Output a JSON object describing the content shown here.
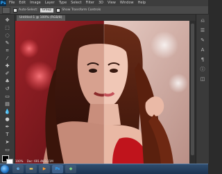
{
  "app": {
    "logo_text": "Ps"
  },
  "menu": {
    "items": [
      "File",
      "Edit",
      "Image",
      "Layer",
      "Type",
      "Select",
      "Filter",
      "3D",
      "View",
      "Window",
      "Help"
    ]
  },
  "options_bar": {
    "auto_select_label": "Auto-Select:",
    "auto_select_value": "Group",
    "show_transform_label": "Show Transform Controls"
  },
  "document": {
    "tab_label": "Untitled-1 @ 100% (RGB/8)"
  },
  "status_bar": {
    "zoom": "100%",
    "doc_info": "Doc: 691.4K/3.21M"
  },
  "taskbar": {
    "items": [
      "ie",
      "folder",
      "media",
      "ps",
      "app"
    ]
  },
  "colors": {
    "app_bg": "#2b2b2b",
    "panel_bg": "#3a3a3a",
    "accent": "#31a8ff",
    "canvas_left_bg": "#8b1c22",
    "canvas_right_bg": "#c8a59c"
  }
}
